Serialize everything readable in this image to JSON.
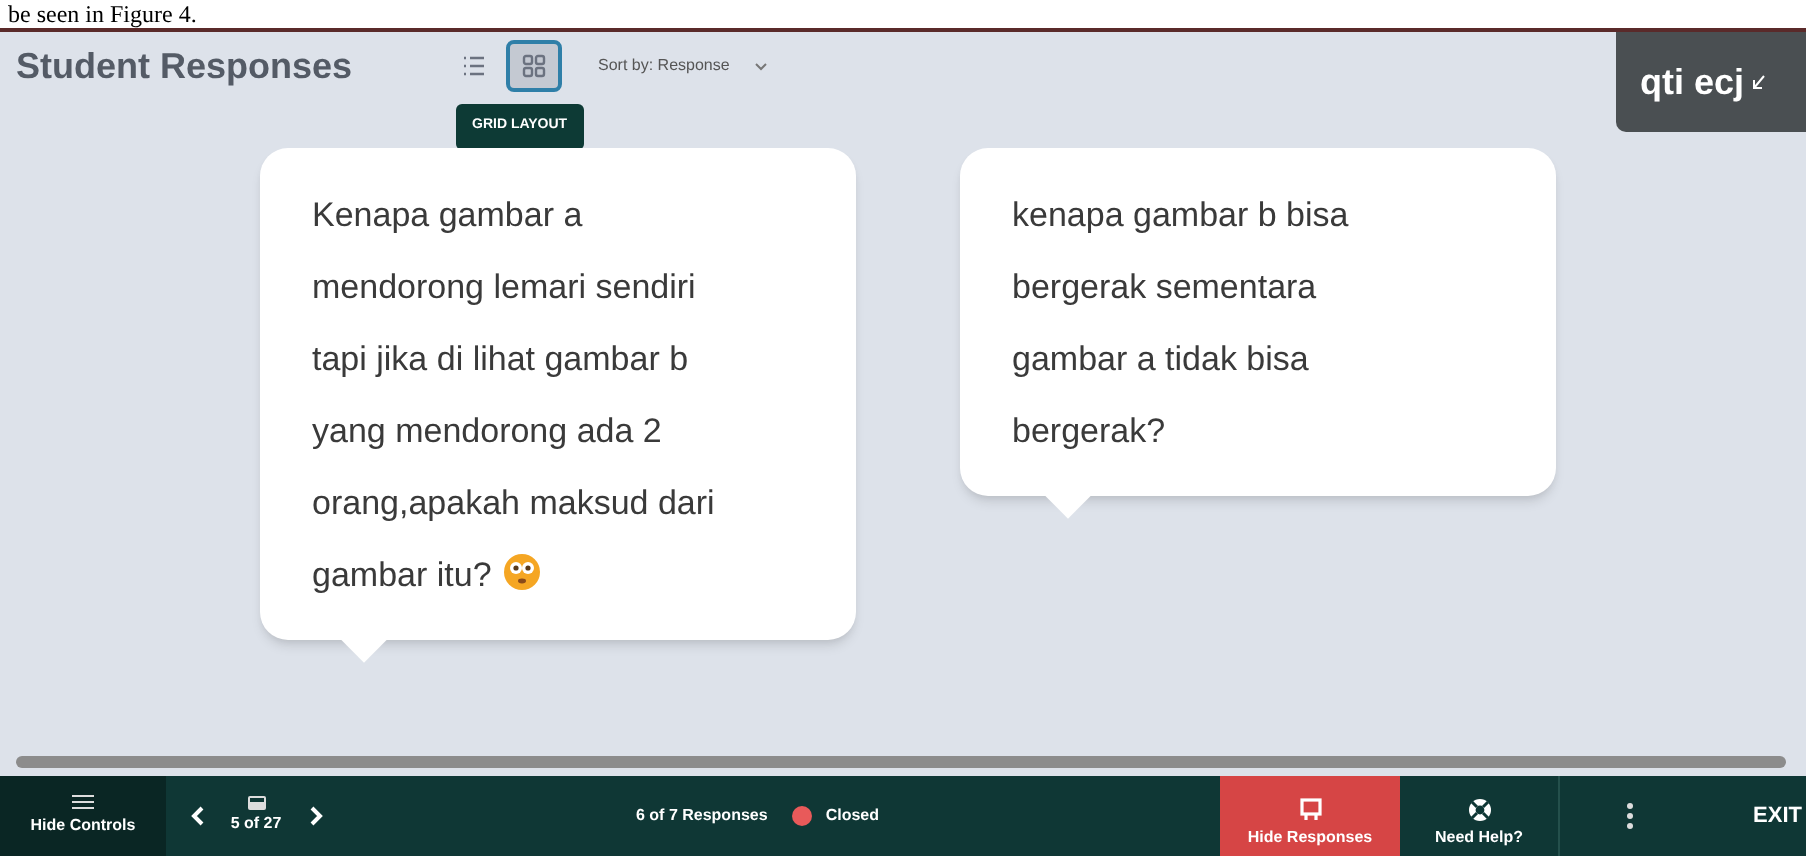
{
  "caption_fragment": "be seen in Figure 4.",
  "header": {
    "title": "Student Responses",
    "views": [
      {
        "kind": "list",
        "selected": false
      },
      {
        "kind": "grid",
        "selected": true
      }
    ],
    "sort": "Sort by: Response",
    "tooltip": "GRID LAYOUT"
  },
  "user_tab": {
    "label": "qti ecj"
  },
  "responses": [
    {
      "text": "Kenapa gambar a mendorong lemari sendiri tapi jika di lihat gambar b yang mendorong ada 2 orang,apakah maksud dari gambar itu?",
      "emoji": true
    },
    {
      "text": "kenapa gambar b bisa bergerak sementara gambar a tidak bisa bergerak?",
      "emoji": false
    }
  ],
  "bottom_bar": {
    "hide_controls": "Hide Controls",
    "slide_counter": "5 of 27",
    "response_count": "6 of 7 Responses",
    "status": {
      "label": "Closed",
      "color": "#e85a5a"
    },
    "hide_responses": "Hide Responses",
    "need_help": "Need Help?",
    "exit": "EXIT"
  }
}
